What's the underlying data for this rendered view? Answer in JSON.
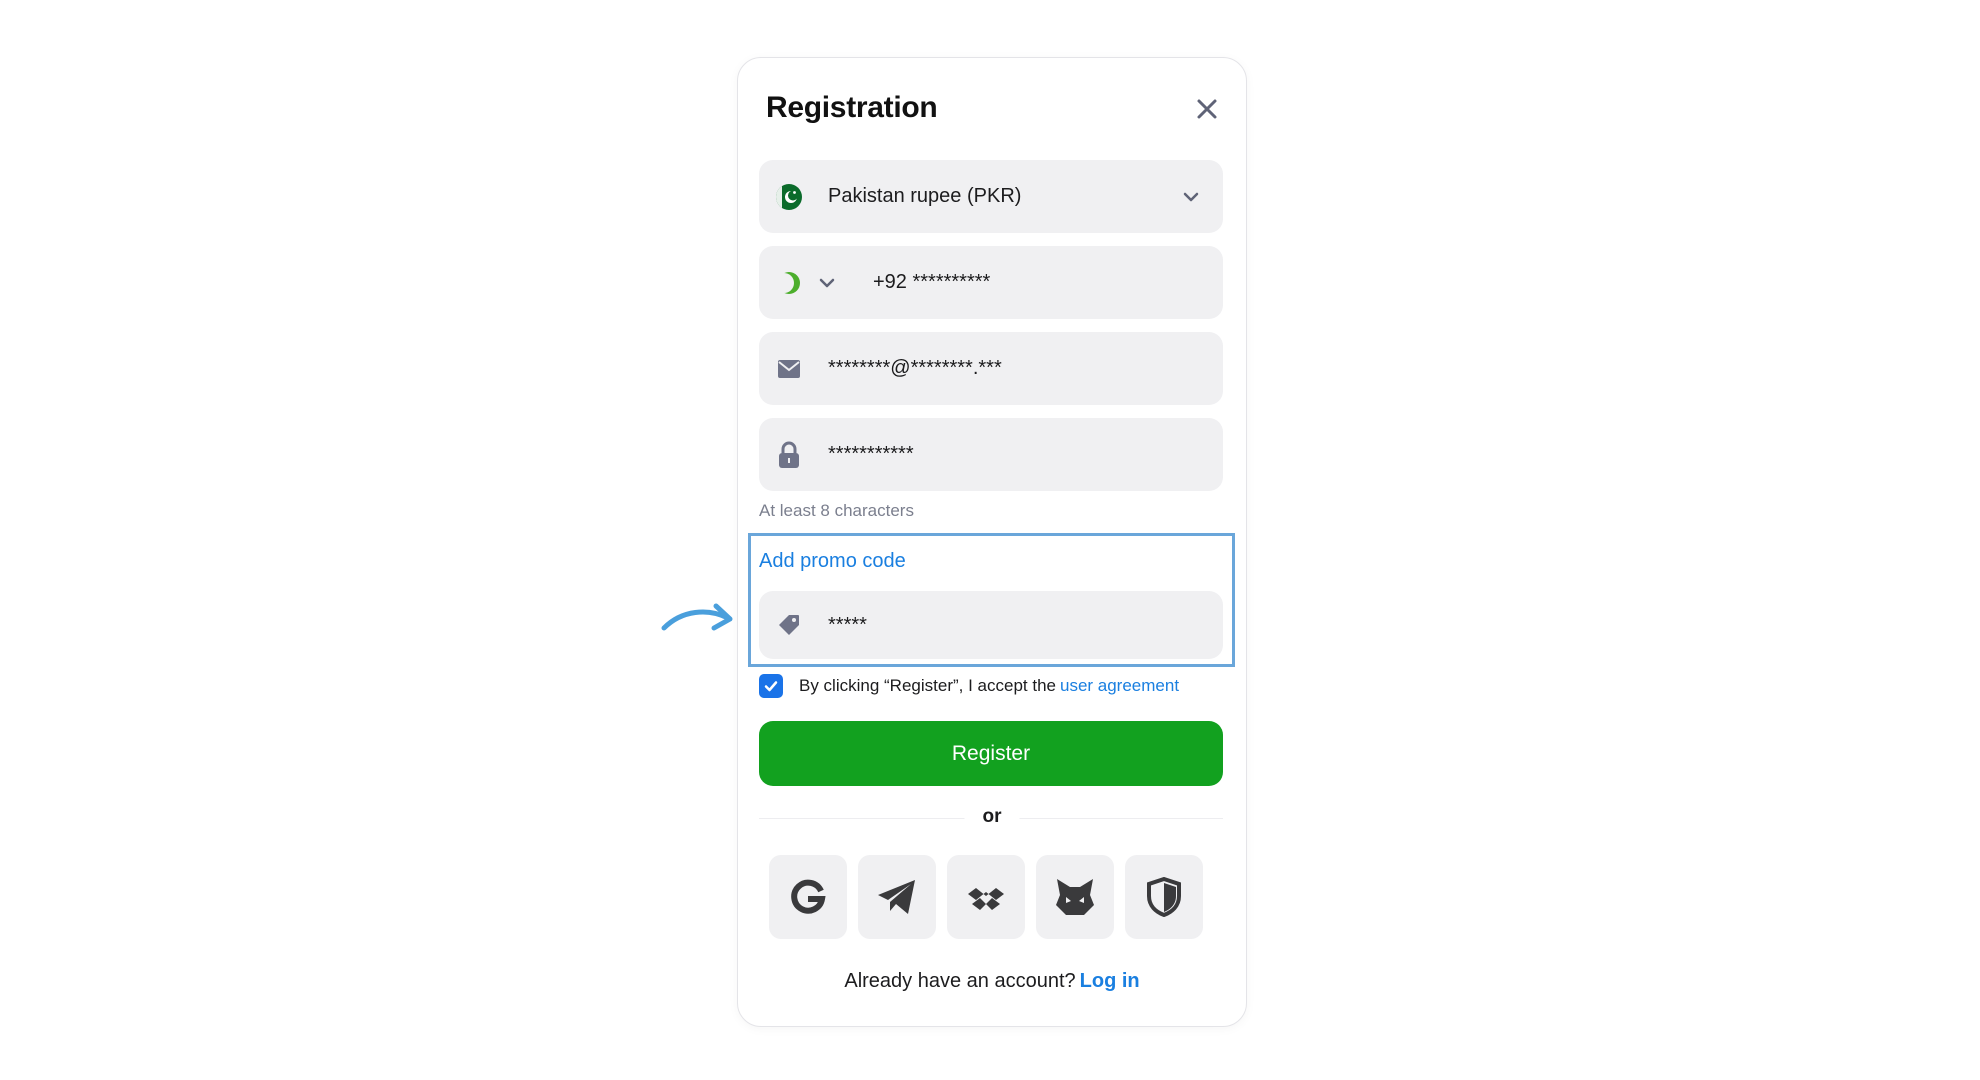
{
  "modal": {
    "title": "Registration"
  },
  "currency": {
    "value": "Pakistan rupee (PKR)",
    "icon": "pakistan-flag-icon"
  },
  "phone": {
    "value": "+92 **********",
    "icon": "crescent-flag-icon"
  },
  "email": {
    "value": "********@********.***",
    "icon": "envelope-icon"
  },
  "password": {
    "value": "***********",
    "icon": "lock-icon",
    "hint": "At least 8 characters"
  },
  "promo": {
    "link_label": "Add promo code",
    "value": "*****",
    "icon": "tag-icon"
  },
  "agreement": {
    "checked": true,
    "text": "By clicking “Register”, I accept the",
    "link": "user agreement"
  },
  "register": {
    "label": "Register"
  },
  "divider": {
    "label": "or"
  },
  "social": [
    {
      "icon": "google-icon"
    },
    {
      "icon": "telegram-icon"
    },
    {
      "icon": "walletconnect-icon"
    },
    {
      "icon": "metamask-fox-icon"
    },
    {
      "icon": "shield-icon"
    }
  ],
  "footer": {
    "text": "Already have an account?",
    "link": "Log in"
  },
  "colors": {
    "accent_green": "#12a11f",
    "link_blue": "#1a7fe0",
    "highlight_blue": "#6aa6da",
    "field_bg": "#f0f0f2"
  }
}
